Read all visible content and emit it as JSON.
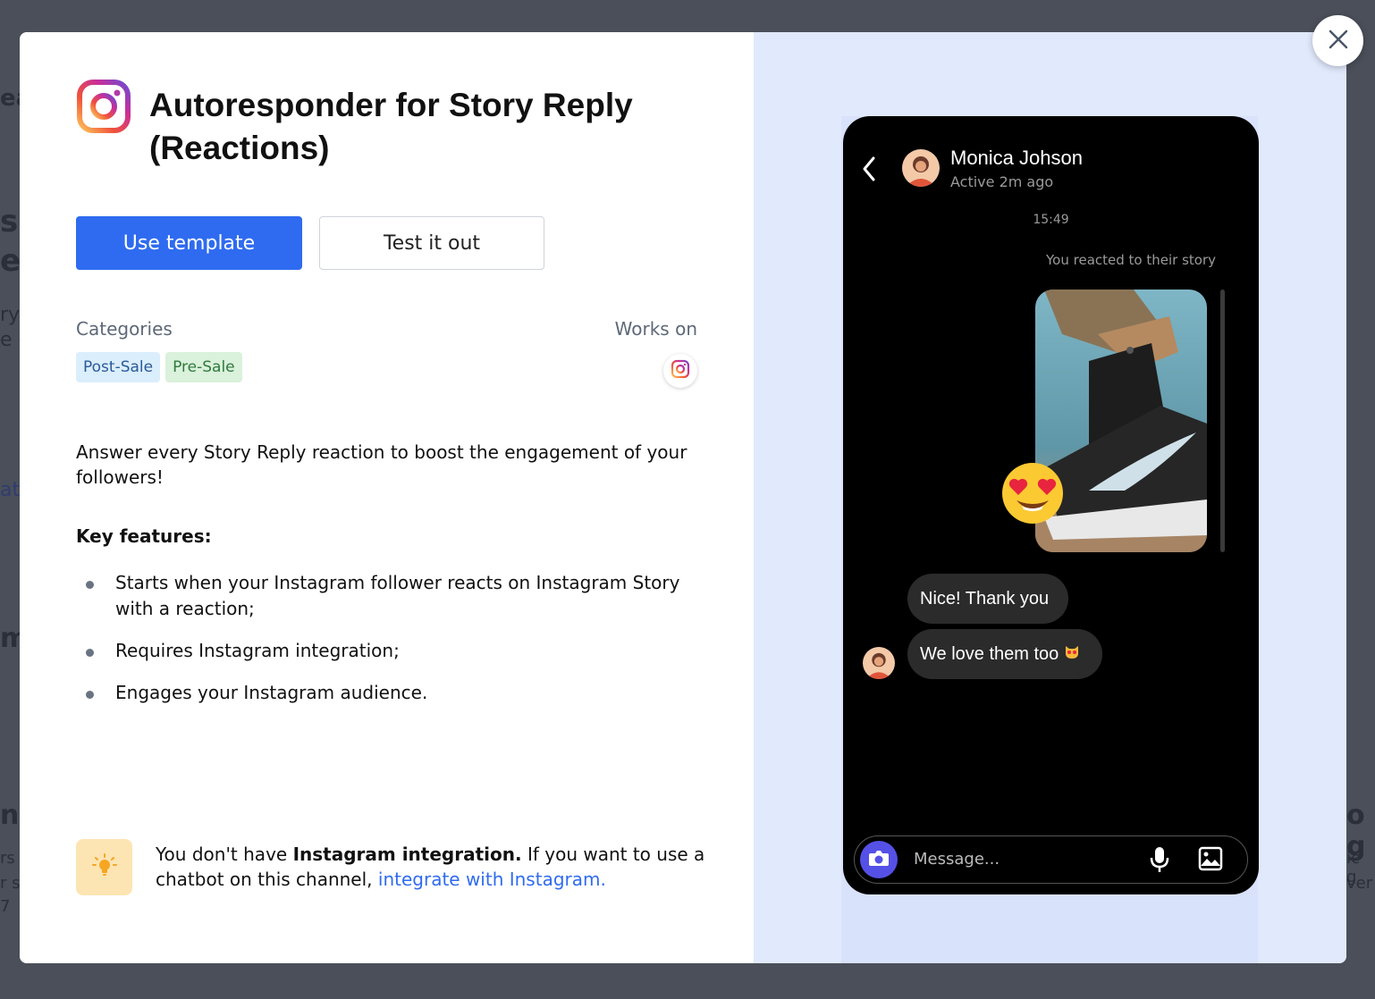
{
  "background": {
    "fragments": [
      "ea",
      "sp",
      "ep",
      "ry",
      "e e",
      "at",
      "m",
      "nl",
      "rs",
      "r sc",
      "7",
      "o g",
      "ic g",
      "ver"
    ]
  },
  "modal": {
    "title": "Autoresponder for Story Reply (Reactions)",
    "use_template_label": "Use template",
    "test_label": "Test it out",
    "categories_label": "Categories",
    "works_on_label": "Works on",
    "tags": [
      "Post-Sale",
      "Pre-Sale"
    ],
    "description": "Answer every Story Reply reaction to boost the engagement of your followers!",
    "key_features_title": "Key features:",
    "features": [
      "Starts when your Instagram follower reacts on Instagram Story with a reaction;",
      "Requires Instagram integration;",
      "Engages your Instagram audience."
    ],
    "notice": {
      "prefix": "You don't have ",
      "bold": "Instagram integration.",
      "middle": " If you want to use a chatbot on this channel, ",
      "link": "integrate with Instagram."
    }
  },
  "phone": {
    "contact_name": "Monica Johson",
    "contact_status": "Active 2m ago",
    "time": "15:49",
    "reacted_text": "You reacted to their story",
    "bubble1": "Nice! Thank you",
    "bubble2": "We love them too",
    "composer_placeholder": "Message..."
  },
  "colors": {
    "primary": "#2f6bf0",
    "right_panel": "#e1e9fd",
    "tag_post_bg": "#dbeefc",
    "tag_pre_bg": "#daf1dc",
    "notice_bg": "#fde4b3"
  },
  "icons": [
    "instagram-logo-icon",
    "instagram-small-icon",
    "lightbulb-icon",
    "close-icon",
    "back-chevron-icon",
    "camera-icon",
    "mic-icon",
    "image-icon",
    "heart-eyes-emoji-icon"
  ]
}
